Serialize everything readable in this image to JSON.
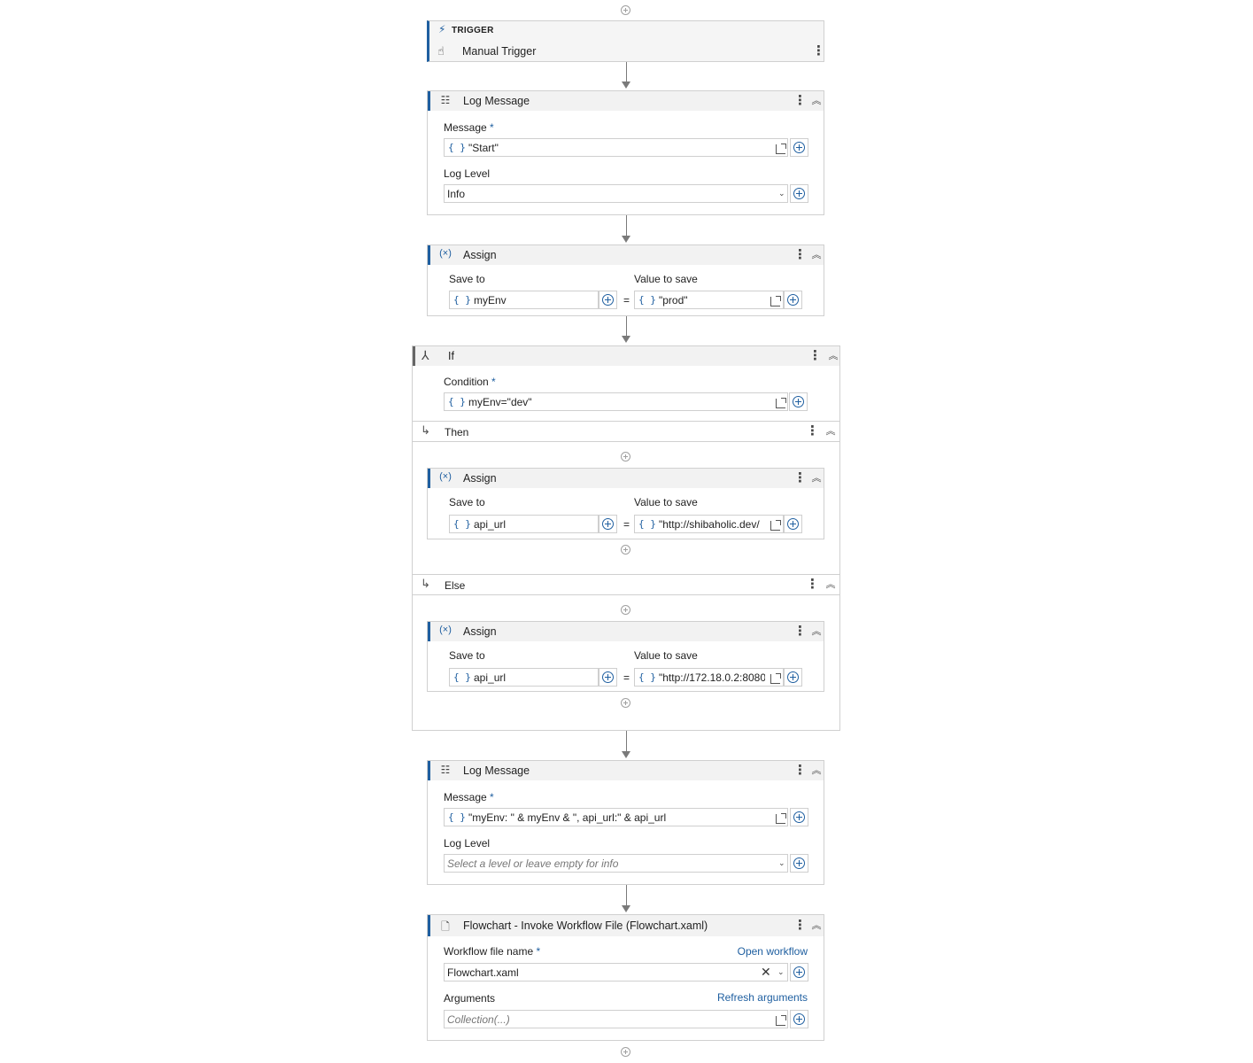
{
  "trigger": {
    "label": "TRIGGER",
    "title": "Manual Trigger"
  },
  "log1": {
    "title": "Log Message",
    "message_label": "Message",
    "message_value": "\"Start\"",
    "level_label": "Log Level",
    "level_value": "Info"
  },
  "assign1": {
    "title": "Assign",
    "save_label": "Save to",
    "value_label": "Value to save",
    "save_value": "myEnv",
    "value_value": "\"prod\""
  },
  "if_block": {
    "title": "If",
    "condition_label": "Condition",
    "condition_value": "myEnv=\"dev\"",
    "then_label": "Then",
    "else_label": "Else"
  },
  "assign_then": {
    "title": "Assign",
    "save_label": "Save to",
    "value_label": "Value to save",
    "save_value": "api_url",
    "value_value": "\"http://shibaholic.dev/"
  },
  "assign_else": {
    "title": "Assign",
    "save_label": "Save to",
    "value_label": "Value to save",
    "save_value": "api_url",
    "value_value": "\"http://172.18.0.2:8080"
  },
  "log2": {
    "title": "Log Message",
    "message_label": "Message",
    "message_value": "\"myEnv: \" & myEnv & \", api_url:\" & api_url",
    "level_label": "Log Level",
    "level_placeholder": "Select a level or leave empty for info"
  },
  "invoke": {
    "title": "Flowchart - Invoke Workflow File (Flowchart.xaml)",
    "file_label": "Workflow file name",
    "open_link": "Open workflow",
    "file_value": "Flowchart.xaml",
    "args_label": "Arguments",
    "refresh_link": "Refresh arguments",
    "args_placeholder": "Collection(...)"
  },
  "common": {
    "required_mark": "*",
    "braces": "{ }",
    "equals": "="
  },
  "icons": {
    "trigger": "lightning-icon",
    "manual": "hand-pointer-icon",
    "log": "log-message-icon",
    "assign": "assign-variable-icon",
    "if": "branch-icon",
    "branch": "branch-arrow-icon",
    "invoke": "invoke-file-icon",
    "more": "kebab-menu-icon",
    "collapse": "collapse-chevron-icon",
    "expand": "expand-editor-icon",
    "add": "add-circle-icon"
  },
  "colors": {
    "accent": "#1f5fa0",
    "header_bg": "#f2f2f2",
    "border": "#d0d0d0"
  }
}
